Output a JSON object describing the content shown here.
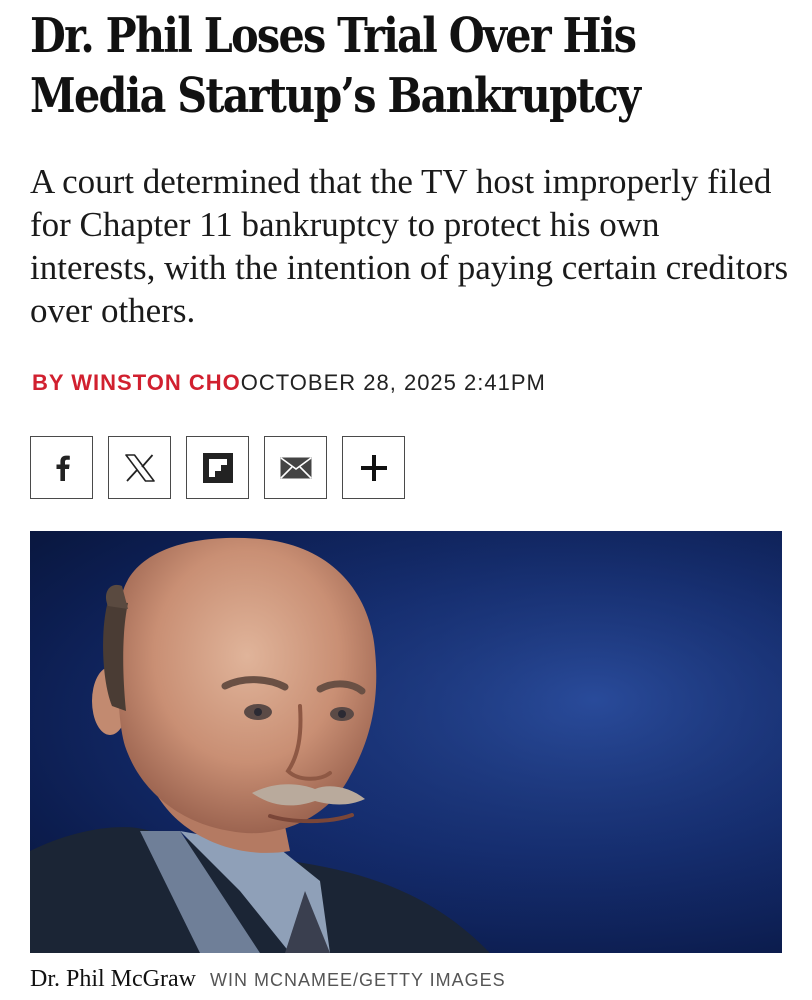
{
  "article": {
    "headline_line1": "Dr. Phil Loses Trial Over His",
    "headline_line2": "Media Startup’s Bankruptcy",
    "dek": "A court determined that the TV host improperly filed for Chapter 11 bankruptcy to protect his own interests, with the intention of paying certain creditors over others.",
    "byline_author": "BY WINSTON CHO",
    "byline_date": "OCTOBER 28, 2025 2:41PM",
    "image_caption": "Dr. Phil McGraw",
    "image_credit": "WIN MCNAMEE/GETTY IMAGES"
  },
  "share_buttons": [
    {
      "icon": "facebook-icon"
    },
    {
      "icon": "x-icon"
    },
    {
      "icon": "flipboard-icon"
    },
    {
      "icon": "email-icon"
    },
    {
      "icon": "plus-icon"
    }
  ],
  "colors": {
    "author": "#d1202f",
    "photo_background": "#162f73"
  }
}
